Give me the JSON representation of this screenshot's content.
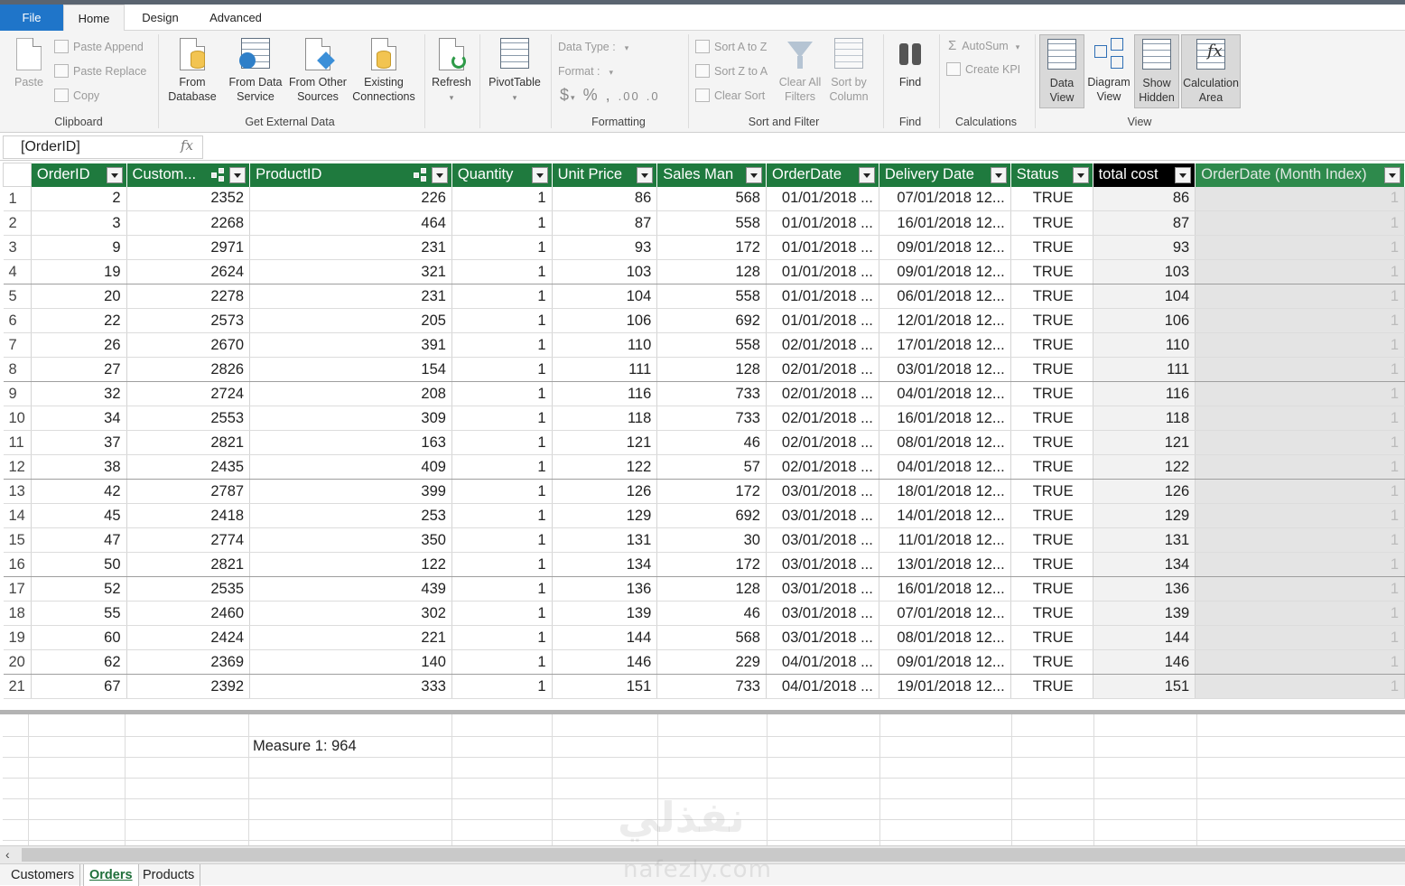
{
  "tabs": {
    "file": "File",
    "home": "Home",
    "design": "Design",
    "advanced": "Advanced"
  },
  "ribbon": {
    "clipboard": {
      "paste": "Paste",
      "paste_append": "Paste Append",
      "paste_replace": "Paste Replace",
      "copy": "Copy",
      "label": "Clipboard"
    },
    "external": {
      "from_database": "From Database",
      "from_data_service": "From Data Service",
      "from_other_sources": "From Other Sources",
      "existing_connections": "Existing Connections",
      "label": "Get External Data"
    },
    "refresh": "Refresh",
    "pivottable": "PivotTable",
    "formatting": {
      "data_type": "Data Type :",
      "format": "Format :",
      "label": "Formatting"
    },
    "sort": {
      "sort_az": "Sort A to Z",
      "sort_za": "Sort Z to A",
      "clear_sort": "Clear Sort",
      "clear_all_filters": "Clear All Filters",
      "sort_by_column": "Sort by Column",
      "label": "Sort and Filter"
    },
    "find": {
      "find": "Find",
      "label": "Find"
    },
    "calculations": {
      "autosum": "AutoSum",
      "create_kpi": "Create KPI",
      "label": "Calculations"
    },
    "view": {
      "data_view": "Data View",
      "diagram_view": "Diagram View",
      "show_hidden": "Show Hidden",
      "calculation_area": "Calculation Area",
      "label": "View"
    }
  },
  "formula_bar": {
    "name_box": "[OrderID]",
    "fx": "fx"
  },
  "columns": [
    "OrderID",
    "Custom...",
    "ProductID",
    "Quantity",
    "Unit Price",
    "Sales Man",
    "OrderDate",
    "Delivery Date",
    "Status",
    "total cost",
    "OrderDate (Month Index)"
  ],
  "rows": [
    [
      "1",
      "2",
      "2352",
      "226",
      "1",
      "86",
      "568",
      "01/01/2018 ...",
      "07/01/2018 12...",
      "TRUE",
      "86",
      "1"
    ],
    [
      "2",
      "3",
      "2268",
      "464",
      "1",
      "87",
      "558",
      "01/01/2018 ...",
      "16/01/2018 12...",
      "TRUE",
      "87",
      "1"
    ],
    [
      "3",
      "9",
      "2971",
      "231",
      "1",
      "93",
      "172",
      "01/01/2018 ...",
      "09/01/2018 12...",
      "TRUE",
      "93",
      "1"
    ],
    [
      "4",
      "19",
      "2624",
      "321",
      "1",
      "103",
      "128",
      "01/01/2018 ...",
      "09/01/2018 12...",
      "TRUE",
      "103",
      "1"
    ],
    [
      "5",
      "20",
      "2278",
      "231",
      "1",
      "104",
      "558",
      "01/01/2018 ...",
      "06/01/2018 12...",
      "TRUE",
      "104",
      "1"
    ],
    [
      "6",
      "22",
      "2573",
      "205",
      "1",
      "106",
      "692",
      "01/01/2018 ...",
      "12/01/2018 12...",
      "TRUE",
      "106",
      "1"
    ],
    [
      "7",
      "26",
      "2670",
      "391",
      "1",
      "110",
      "558",
      "02/01/2018 ...",
      "17/01/2018 12...",
      "TRUE",
      "110",
      "1"
    ],
    [
      "8",
      "27",
      "2826",
      "154",
      "1",
      "111",
      "128",
      "02/01/2018 ...",
      "03/01/2018 12...",
      "TRUE",
      "111",
      "1"
    ],
    [
      "9",
      "32",
      "2724",
      "208",
      "1",
      "116",
      "733",
      "02/01/2018 ...",
      "04/01/2018 12...",
      "TRUE",
      "116",
      "1"
    ],
    [
      "10",
      "34",
      "2553",
      "309",
      "1",
      "118",
      "733",
      "02/01/2018 ...",
      "16/01/2018 12...",
      "TRUE",
      "118",
      "1"
    ],
    [
      "11",
      "37",
      "2821",
      "163",
      "1",
      "121",
      "46",
      "02/01/2018 ...",
      "08/01/2018 12...",
      "TRUE",
      "121",
      "1"
    ],
    [
      "12",
      "38",
      "2435",
      "409",
      "1",
      "122",
      "57",
      "02/01/2018 ...",
      "04/01/2018 12...",
      "TRUE",
      "122",
      "1"
    ],
    [
      "13",
      "42",
      "2787",
      "399",
      "1",
      "126",
      "172",
      "03/01/2018 ...",
      "18/01/2018 12...",
      "TRUE",
      "126",
      "1"
    ],
    [
      "14",
      "45",
      "2418",
      "253",
      "1",
      "129",
      "692",
      "03/01/2018 ...",
      "14/01/2018 12...",
      "TRUE",
      "129",
      "1"
    ],
    [
      "15",
      "47",
      "2774",
      "350",
      "1",
      "131",
      "30",
      "03/01/2018 ...",
      "11/01/2018 12...",
      "TRUE",
      "131",
      "1"
    ],
    [
      "16",
      "50",
      "2821",
      "122",
      "1",
      "134",
      "172",
      "03/01/2018 ...",
      "13/01/2018 12...",
      "TRUE",
      "134",
      "1"
    ],
    [
      "17",
      "52",
      "2535",
      "439",
      "1",
      "136",
      "128",
      "03/01/2018 ...",
      "16/01/2018 12...",
      "TRUE",
      "136",
      "1"
    ],
    [
      "18",
      "55",
      "2460",
      "302",
      "1",
      "139",
      "46",
      "03/01/2018 ...",
      "07/01/2018 12...",
      "TRUE",
      "139",
      "1"
    ],
    [
      "19",
      "60",
      "2424",
      "221",
      "1",
      "144",
      "568",
      "03/01/2018 ...",
      "08/01/2018 12...",
      "TRUE",
      "144",
      "1"
    ],
    [
      "20",
      "62",
      "2369",
      "140",
      "1",
      "146",
      "229",
      "04/01/2018 ...",
      "09/01/2018 12...",
      "TRUE",
      "146",
      "1"
    ],
    [
      "21",
      "67",
      "2392",
      "333",
      "1",
      "151",
      "733",
      "04/01/2018 ...",
      "19/01/2018 12...",
      "TRUE",
      "151",
      "1"
    ]
  ],
  "measure": "Measure 1: 964",
  "sheets": [
    "Customers",
    "Orders",
    "Products"
  ],
  "active_sheet": "Orders",
  "watermark": {
    "arabic": "نفذلي",
    "latin": "nafezly.com"
  }
}
